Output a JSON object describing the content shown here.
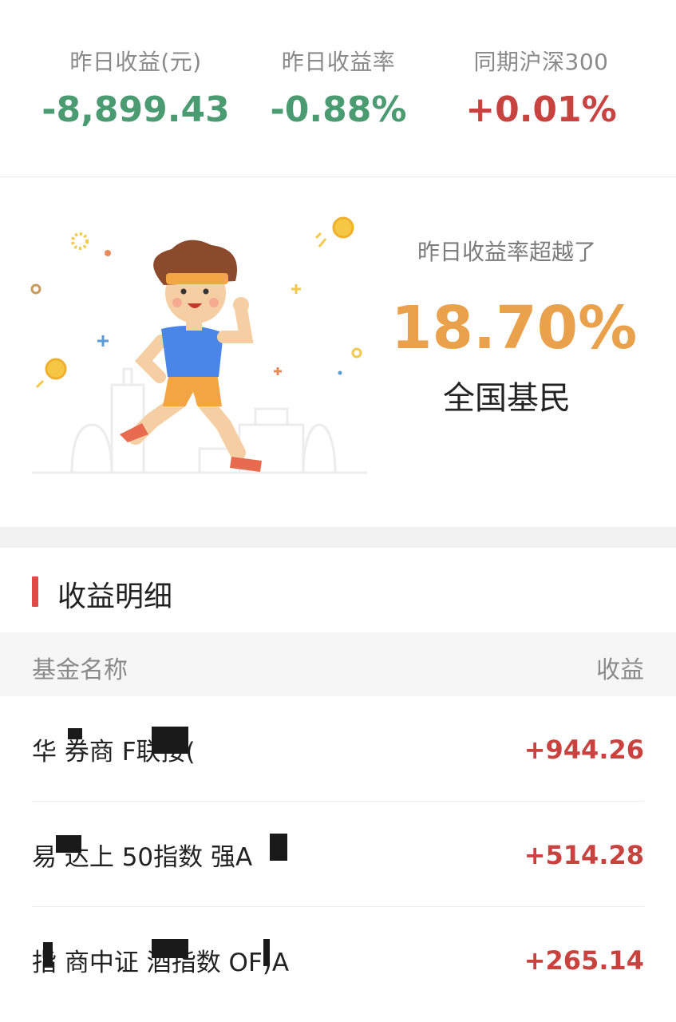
{
  "summary": {
    "yesterday_income": {
      "label": "昨日收益(元)",
      "value": "-8,899.43",
      "color": "#4a9a72"
    },
    "yesterday_rate": {
      "label": "昨日收益率",
      "value": "-0.88%",
      "color": "#4a9a72"
    },
    "hs300": {
      "label": "同期沪深300",
      "value": "+0.01%",
      "color": "#c8433f"
    }
  },
  "beat": {
    "caption": "昨日收益率超越了",
    "percent": "18.70%",
    "subject": "全国基民",
    "illustration_icon": "running-man-illustration",
    "accent": "#eaa14c"
  },
  "details": {
    "title": "收益明细",
    "header": {
      "name": "基金名称",
      "value": "收益"
    },
    "rows": [
      {
        "name": "华  券商   F联接(",
        "gain": "+944.26"
      },
      {
        "name": "易  达上  50指数  强A",
        "gain": "+514.28"
      },
      {
        "name": "指  商中证   酒指数  OF)A",
        "gain": "+265.14"
      }
    ],
    "gain_color": "#c8433f"
  }
}
